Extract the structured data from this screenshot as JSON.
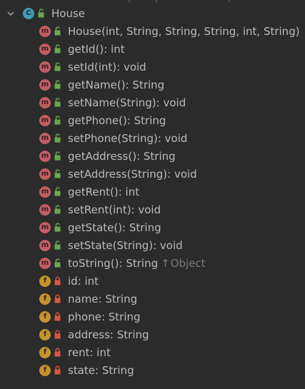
{
  "tree": {
    "root": {
      "label": "House",
      "badge": "C",
      "icon": "class-icon",
      "expanded": true
    },
    "members": [
      {
        "badge": "m",
        "kind": "method",
        "access": "public",
        "label": "House(int, String, String, String, int, String)"
      },
      {
        "badge": "m",
        "kind": "method",
        "access": "public",
        "label": "getId(): int"
      },
      {
        "badge": "m",
        "kind": "method",
        "access": "public",
        "label": "setId(int): void"
      },
      {
        "badge": "m",
        "kind": "method",
        "access": "public",
        "label": "getName(): String"
      },
      {
        "badge": "m",
        "kind": "method",
        "access": "public",
        "label": "setName(String): void"
      },
      {
        "badge": "m",
        "kind": "method",
        "access": "public",
        "label": "getPhone(): String"
      },
      {
        "badge": "m",
        "kind": "method",
        "access": "public",
        "label": "setPhone(String): void"
      },
      {
        "badge": "m",
        "kind": "method",
        "access": "public",
        "label": "getAddress(): String"
      },
      {
        "badge": "m",
        "kind": "method",
        "access": "public",
        "label": "setAddress(String): void"
      },
      {
        "badge": "m",
        "kind": "method",
        "access": "public",
        "label": "getRent(): int"
      },
      {
        "badge": "m",
        "kind": "method",
        "access": "public",
        "label": "setRent(int): void"
      },
      {
        "badge": "m",
        "kind": "method",
        "access": "public",
        "label": "getState(): String"
      },
      {
        "badge": "m",
        "kind": "method",
        "access": "public",
        "label": "setState(String): void"
      },
      {
        "badge": "m",
        "kind": "method",
        "access": "public",
        "label": "toString(): String",
        "inherited_from": "Object",
        "inherit_arrow": "↑"
      },
      {
        "badge": "f",
        "kind": "field",
        "access": "private",
        "label": "id: int"
      },
      {
        "badge": "f",
        "kind": "field",
        "access": "private",
        "label": "name: String"
      },
      {
        "badge": "f",
        "kind": "field",
        "access": "private",
        "label": "phone: String"
      },
      {
        "badge": "f",
        "kind": "field",
        "access": "private",
        "label": "address: String"
      },
      {
        "badge": "f",
        "kind": "field",
        "access": "private",
        "label": "rent: int"
      },
      {
        "badge": "f",
        "kind": "field",
        "access": "private",
        "label": "state: String"
      }
    ]
  },
  "colors": {
    "background": "#2b2b2b",
    "text": "#bbbbbb",
    "inherited_text": "#787878",
    "class_badge": "#3e9db6",
    "method_badge": "#c25e63",
    "field_badge": "#c4932e",
    "public_lock": "#6aa84f",
    "private_lock": "#d9573e"
  }
}
